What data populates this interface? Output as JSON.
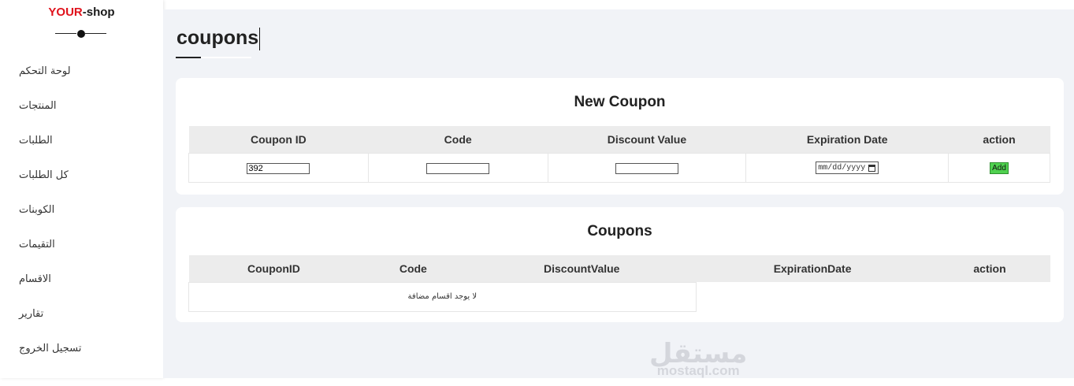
{
  "brand": {
    "part1": "YOUR",
    "part2": "-shop"
  },
  "sidebar": {
    "items": [
      {
        "label": "لوحة التحكم"
      },
      {
        "label": "المنتجات"
      },
      {
        "label": "الطلبات"
      },
      {
        "label": "كل الطلبات"
      },
      {
        "label": "الكوبنات"
      },
      {
        "label": "التقيمات"
      },
      {
        "label": "الاقسام"
      },
      {
        "label": "تقارير"
      },
      {
        "label": "تسجيل الخروج"
      }
    ]
  },
  "page": {
    "title": "coupons"
  },
  "new_coupon": {
    "title": "New Coupon",
    "columns": [
      "Coupon ID",
      "Code",
      "Discount Value",
      "Expiration Date",
      "action"
    ],
    "coupon_id_value": "392",
    "code_value": "",
    "discount_value": "",
    "date_placeholder": "mm/dd/yyyy",
    "add_label": "Add"
  },
  "coupons": {
    "title": "Coupons",
    "columns": [
      "CouponID",
      "Code",
      "DiscountValue",
      "ExpirationDate",
      "action"
    ],
    "empty_message": "لا يوجد اقسام مضافة"
  },
  "watermark": {
    "arabic": "مستقل",
    "latin": "mostaql.com"
  },
  "colors": {
    "brand_red": "#e0121c",
    "add_button": "#4fd14f",
    "header_bg": "#ececec",
    "main_bg": "#f1f3f7"
  }
}
